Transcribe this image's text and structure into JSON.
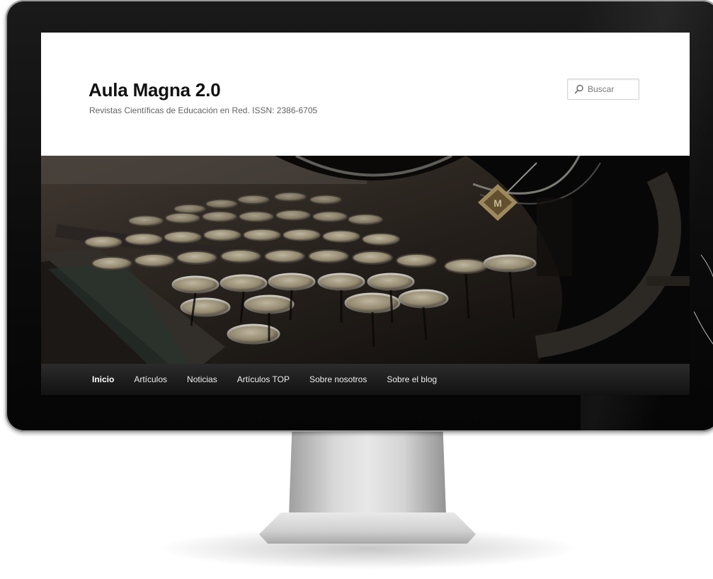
{
  "site": {
    "title": "Aula Magna 2.0",
    "tagline": "Revistas Científicas de Educación en Red. ISSN: 2386-6705"
  },
  "search": {
    "placeholder": "Buscar"
  },
  "nav": {
    "items": [
      {
        "label": "Inicio",
        "active": true
      },
      {
        "label": "Artículos",
        "active": false
      },
      {
        "label": "Noticias",
        "active": false
      },
      {
        "label": "Artículos TOP",
        "active": false
      },
      {
        "label": "Sobre nosotros",
        "active": false
      },
      {
        "label": "Sobre el blog",
        "active": false
      }
    ]
  },
  "hero": {
    "image": "vintage-typewriter-keys-photo"
  },
  "colors": {
    "nav_bg": "#1c1c1c",
    "title": "#111111",
    "tagline": "#636363",
    "bezel": "#0b0b0b"
  }
}
